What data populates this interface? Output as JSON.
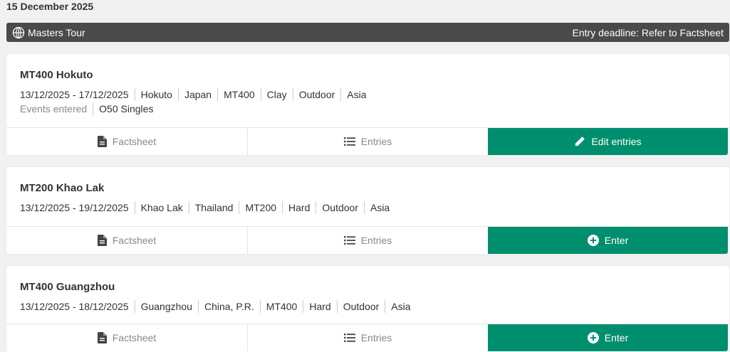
{
  "date": "15 December 2025",
  "tour": {
    "name": "Masters Tour",
    "icon": "globe-icon",
    "deadline": "Entry deadline: Refer to Factsheet",
    "bar_color": "#4a4a4a"
  },
  "accent_color": "#008f6e",
  "cards": [
    {
      "title": "MT400 Hokuto",
      "meta": [
        "13/12/2025 - 17/12/2025",
        "Hokuto",
        "Japan",
        "MT400",
        "Clay",
        "Outdoor",
        "Asia"
      ],
      "events_label": "Events entered",
      "events_value": "O50 Singles",
      "factsheet": "Factsheet",
      "entries": "Entries",
      "primary": "Edit entries",
      "primary_icon": "pencil-icon"
    },
    {
      "title": "MT200 Khao Lak",
      "meta": [
        "13/12/2025 - 19/12/2025",
        "Khao Lak",
        "Thailand",
        "MT200",
        "Hard",
        "Outdoor",
        "Asia"
      ],
      "factsheet": "Factsheet",
      "entries": "Entries",
      "primary": "Enter",
      "primary_icon": "plus-circle-icon"
    },
    {
      "title": "MT400 Guangzhou",
      "meta": [
        "13/12/2025 - 18/12/2025",
        "Guangzhou",
        "China, P.R.",
        "MT400",
        "Hard",
        "Outdoor",
        "Asia"
      ],
      "factsheet": "Factsheet",
      "entries": "Entries",
      "primary": "Enter",
      "primary_icon": "plus-circle-icon"
    }
  ]
}
